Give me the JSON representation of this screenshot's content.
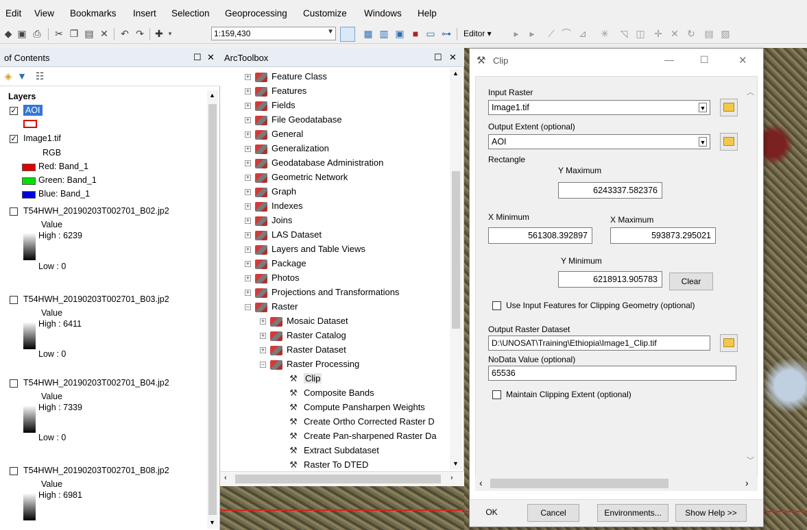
{
  "menu": [
    "Edit",
    "View",
    "Bookmarks",
    "Insert",
    "Selection",
    "Geoprocessing",
    "Customize",
    "Windows",
    "Help"
  ],
  "toolbar": {
    "scale": "1:159,430",
    "editor_label": "Editor ▾",
    "icons": [
      "new-icon",
      "save-icon",
      "print-icon",
      "cut-icon",
      "copy-icon",
      "paste-icon",
      "delete-icon",
      "undo-icon",
      "redo-icon",
      "add-data-icon"
    ]
  },
  "toc": {
    "title": "of Contents",
    "layers_heading": "Layers",
    "layers": [
      {
        "name": "AOI"
      },
      {
        "name": "Image1.tif",
        "renderer": "RGB",
        "bands": [
          {
            "label": "Red:   Band_1",
            "color": "#e00000"
          },
          {
            "label": "Green: Band_1",
            "color": "#00e000"
          },
          {
            "label": "Blue:  Band_1",
            "color": "#0000e0"
          }
        ]
      },
      {
        "name": "T54HWH_20190203T002701_B02.jp2",
        "value_label": "Value",
        "high": "High : 6239",
        "low": "Low : 0"
      },
      {
        "name": "T54HWH_20190203T002701_B03.jp2",
        "value_label": "Value",
        "high": "High : 6411",
        "low": "Low : 0"
      },
      {
        "name": "T54HWH_20190203T002701_B04.jp2",
        "value_label": "Value",
        "high": "High : 7339",
        "low": "Low : 0"
      },
      {
        "name": "T54HWH_20190203T002701_B08.jp2",
        "value_label": "Value",
        "high": "High : 6981"
      }
    ]
  },
  "toolbox": {
    "title": "ArcToolbox",
    "items": [
      "Feature Class",
      "Features",
      "Fields",
      "File Geodatabase",
      "General",
      "Generalization",
      "Geodatabase Administration",
      "Geometric Network",
      "Graph",
      "Indexes",
      "Joins",
      "LAS Dataset",
      "Layers and Table Views",
      "Package",
      "Photos",
      "Projections and Transformations",
      "Raster"
    ],
    "raster_children": [
      "Mosaic Dataset",
      "Raster Catalog",
      "Raster Dataset",
      "Raster Processing"
    ],
    "raster_processing_tools": [
      "Clip",
      "Composite Bands",
      "Compute Pansharpen Weights",
      "Create Ortho Corrected Raster D",
      "Create Pan-sharpened Raster Da",
      "Extract Subdataset",
      "Raster To DTED"
    ]
  },
  "clip": {
    "title": "Clip",
    "input_raster_label": "Input Raster",
    "input_raster_value": "Image1.tif",
    "output_extent_label": "Output Extent (optional)",
    "output_extent_value": "AOI",
    "rectangle_label": "Rectangle",
    "y_max_label": "Y Maximum",
    "y_max_value": "6243337.582376",
    "x_min_label": "X Minimum",
    "x_min_value": "561308.392897",
    "x_max_label": "X Maximum",
    "x_max_value": "593873.295021",
    "y_min_label": "Y Minimum",
    "y_min_value": "6218913.905783",
    "clear_label": "Clear",
    "use_input_features_label": "Use Input Features for Clipping Geometry (optional)",
    "output_raster_label": "Output Raster Dataset",
    "output_raster_value": "D:\\UNOSAT\\Training\\Ethiopia\\Image1_Clip.tif",
    "nodata_label": "NoData Value (optional)",
    "nodata_value": "65536",
    "maintain_extent_label": "Maintain Clipping Extent (optional)",
    "buttons": {
      "ok": "OK",
      "cancel": "Cancel",
      "environments": "Environments...",
      "show_help": "Show Help >>"
    }
  }
}
